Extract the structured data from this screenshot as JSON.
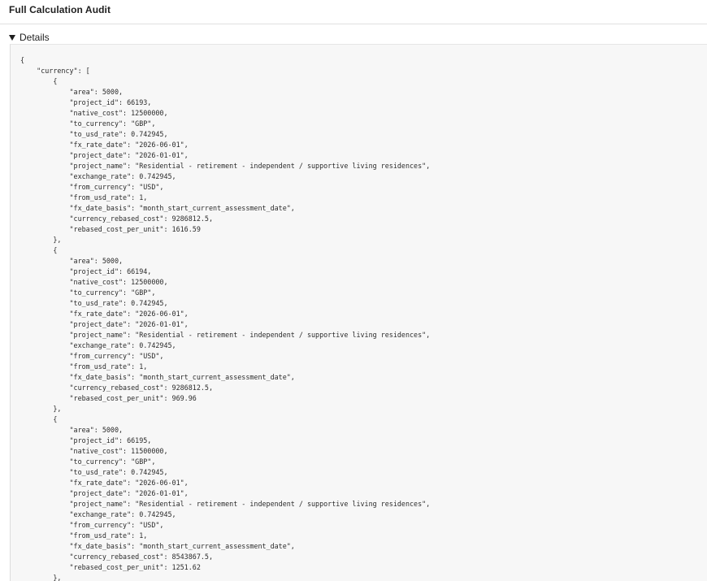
{
  "header": {
    "title": "Full Calculation Audit"
  },
  "details": {
    "summary_label": "Details",
    "code_lines": [
      "{",
      "    \"currency\": [",
      "        {",
      "            \"area\": 5000,",
      "            \"project_id\": 66193,",
      "            \"native_cost\": 12500000,",
      "            \"to_currency\": \"GBP\",",
      "            \"to_usd_rate\": 0.742945,",
      "            \"fx_rate_date\": \"2026-06-01\",",
      "            \"project_date\": \"2026-01-01\",",
      "            \"project_name\": \"Residential - retirement - independent / supportive living residences\",",
      "            \"exchange_rate\": 0.742945,",
      "            \"from_currency\": \"USD\",",
      "            \"from_usd_rate\": 1,",
      "            \"fx_date_basis\": \"month_start_current_assessment_date\",",
      "            \"currency_rebased_cost\": 9286812.5,",
      "            \"rebased_cost_per_unit\": 1616.59",
      "        },",
      "        {",
      "            \"area\": 5000,",
      "            \"project_id\": 66194,",
      "            \"native_cost\": 12500000,",
      "            \"to_currency\": \"GBP\",",
      "            \"to_usd_rate\": 0.742945,",
      "            \"fx_rate_date\": \"2026-06-01\",",
      "            \"project_date\": \"2026-01-01\",",
      "            \"project_name\": \"Residential - retirement - independent / supportive living residences\",",
      "            \"exchange_rate\": 0.742945,",
      "            \"from_currency\": \"USD\",",
      "            \"from_usd_rate\": 1,",
      "            \"fx_date_basis\": \"month_start_current_assessment_date\",",
      "            \"currency_rebased_cost\": 9286812.5,",
      "            \"rebased_cost_per_unit\": 969.96",
      "        },",
      "        {",
      "            \"area\": 5000,",
      "            \"project_id\": 66195,",
      "            \"native_cost\": 11500000,",
      "            \"to_currency\": \"GBP\",",
      "            \"to_usd_rate\": 0.742945,",
      "            \"fx_rate_date\": \"2026-06-01\",",
      "            \"project_date\": \"2026-01-01\",",
      "            \"project_name\": \"Residential - retirement - independent / supportive living residences\",",
      "            \"exchange_rate\": 0.742945,",
      "            \"from_currency\": \"USD\",",
      "            \"from_usd_rate\": 1,",
      "            \"fx_date_basis\": \"month_start_current_assessment_date\",",
      "            \"currency_rebased_cost\": 8543867.5,",
      "            \"rebased_cost_per_unit\": 1251.62",
      "        },"
    ]
  }
}
